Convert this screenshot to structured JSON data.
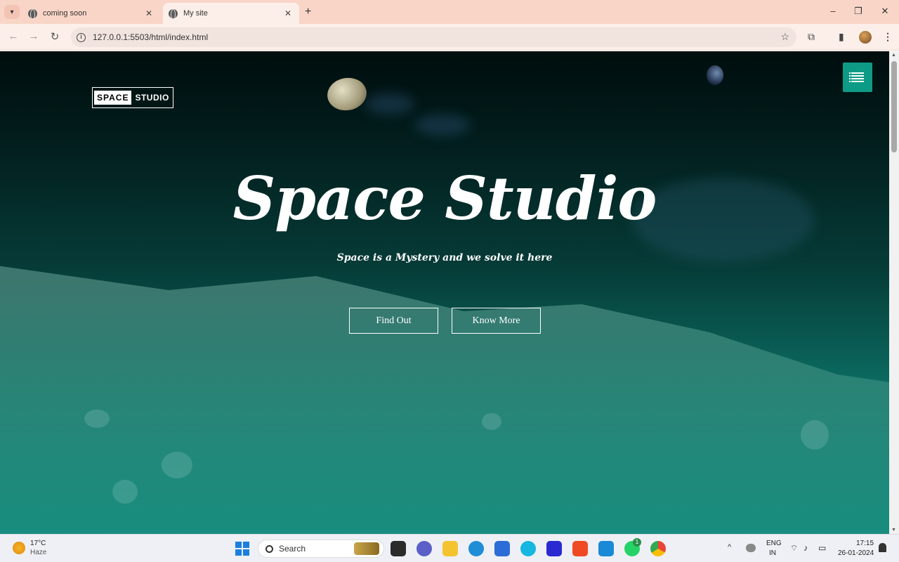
{
  "browser": {
    "tabs": [
      {
        "title": "coming soon",
        "active": false
      },
      {
        "title": "My site",
        "active": true
      }
    ],
    "new_tab_symbol": "+",
    "url": "127.0.0.1:5503/html/index.html",
    "icons": [
      "tab-search-icon",
      "globe-icon",
      "close-icon",
      "back-icon",
      "forward-icon",
      "reload-icon",
      "info-icon",
      "star-icon",
      "extensions-icon",
      "side-panel-icon",
      "profile-avatar",
      "more-menu-icon",
      "minimize-icon",
      "maximize-icon",
      "close-window-icon"
    ]
  },
  "site": {
    "logo": {
      "part1": "SPACE",
      "part2": "STUDIO"
    },
    "title": "Space Studio",
    "subtitle": "Space is a Mystery and we solve it here",
    "buttons": {
      "find_out": "Find Out",
      "know_more": "Know More"
    },
    "menu_icon": "list-icon",
    "colors": {
      "accent": "#0e9b86",
      "text": "#ffffff"
    }
  },
  "taskbar": {
    "weather": {
      "temp": "17°C",
      "desc": "Haze"
    },
    "search_label": "Search",
    "apps": [
      "file-explorer-icon",
      "teams-icon",
      "folder-icon",
      "edge-icon",
      "store-icon",
      "alexa-icon",
      "design-icon",
      "brave-icon",
      "vscode-icon",
      "whatsapp-icon",
      "chrome-icon"
    ],
    "whatsapp_badge": "1",
    "lang_1": "ENG",
    "lang_2": "IN",
    "time": "17:15",
    "date": "26-01-2024"
  }
}
